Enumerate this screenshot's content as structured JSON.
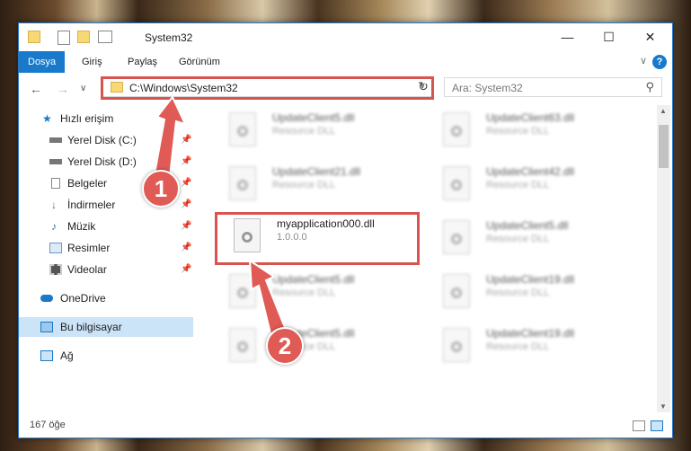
{
  "window": {
    "title": "System32",
    "minimize": "—",
    "maximize": "☐",
    "close": "✕"
  },
  "ribbon": {
    "tabs": [
      {
        "label": "Dosya"
      },
      {
        "label": "Giriş"
      },
      {
        "label": "Paylaş"
      },
      {
        "label": "Görünüm"
      }
    ],
    "help": "?"
  },
  "nav": {
    "back": "←",
    "forward": "→",
    "recent": "∨",
    "up": "↑",
    "address": "C:\\Windows\\System32",
    "search_placeholder": "Ara: System32"
  },
  "sidebar": {
    "items": [
      {
        "label": "Hızlı erişim"
      },
      {
        "label": "Yerel Disk (C:)"
      },
      {
        "label": "Yerel Disk (D:)"
      },
      {
        "label": "Belgeler"
      },
      {
        "label": "İndirmeler"
      },
      {
        "label": "Müzik"
      },
      {
        "label": "Resimler"
      },
      {
        "label": "Videolar"
      },
      {
        "label": "OneDrive"
      },
      {
        "label": "Bu bilgisayar"
      },
      {
        "label": "Ağ"
      }
    ]
  },
  "files": [
    {
      "name": "UpdateClient5.dll",
      "desc": "Resource DLL"
    },
    {
      "name": "UpdateClient63.dll",
      "desc": "Resource DLL"
    },
    {
      "name": "UpdateClient21.dll",
      "desc": "Resource DLL"
    },
    {
      "name": "UpdateClient42.dll",
      "desc": "Resource DLL"
    },
    {
      "name": "myapplication000.dll",
      "desc": "1.0.0.0"
    },
    {
      "name": "UpdateClient5.dll",
      "desc": "Resource DLL"
    },
    {
      "name": "UpdateClient5.dll",
      "desc": "Resource DLL"
    },
    {
      "name": "UpdateClient19.dll",
      "desc": "Resource DLL"
    },
    {
      "name": "UpdateClient5.dll",
      "desc": "Resource DLL"
    },
    {
      "name": "UpdateClient19.dll",
      "desc": "Resource DLL"
    }
  ],
  "status": {
    "count": "167 öğe"
  },
  "callouts": {
    "one": "1",
    "two": "2"
  },
  "colors": {
    "accent": "#1979ca",
    "highlight": "#d9534f"
  }
}
